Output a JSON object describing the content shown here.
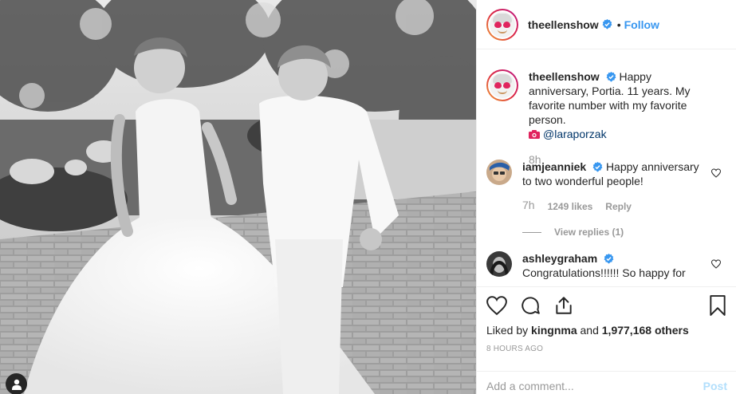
{
  "post": {
    "author": "theellenshow",
    "follow_label": "Follow",
    "separator": "•",
    "caption": {
      "username": "theellenshow",
      "text": "Happy anniversary, Portia. 11 years. My favorite number with my favorite person.",
      "photo_credit": "@laraporzak",
      "age": "8h"
    },
    "comments": [
      {
        "username": "iamjeanniek",
        "text": "Happy anniversary to two wonderful people!",
        "age": "7h",
        "likes": "1249 likes",
        "reply_label": "Reply",
        "view_replies": "View replies (1)"
      },
      {
        "username": "ashleygraham",
        "text": "Congratulations!!!!!! So happy for"
      }
    ],
    "liked_by_prefix": "Liked by",
    "liked_by_user": "kingnma",
    "liked_by_and": "and",
    "liked_by_others": "1,977,168 others",
    "time_ago": "8 HOURS AGO",
    "comment_placeholder": "Add a comment...",
    "post_label": "Post"
  },
  "icons": {
    "verified": "verified-badge-icon",
    "like": "heart-icon",
    "comment": "comment-icon",
    "share": "share-icon",
    "save": "bookmark-icon",
    "tag": "user-tag-icon",
    "camera": "camera-icon"
  },
  "colors": {
    "accent": "#3897f0",
    "verified": "#3897f0",
    "text": "#262626",
    "muted": "#999999",
    "post_disabled": "#b2dffc",
    "border": "#efefef"
  }
}
